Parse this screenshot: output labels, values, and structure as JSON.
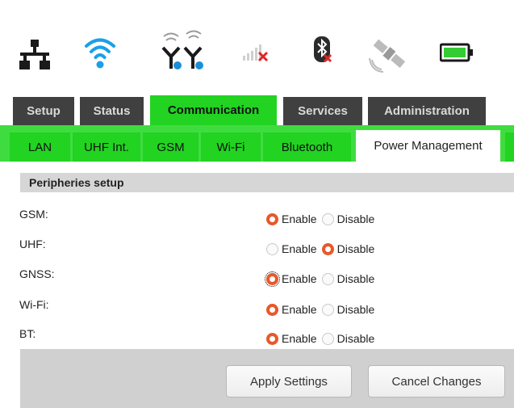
{
  "status_icons": [
    {
      "name": "ethernet-icon",
      "color": "#1a1a1a"
    },
    {
      "name": "wifi-icon",
      "color": "#1aa0e6"
    },
    {
      "name": "uhf-antenna-icon",
      "color": "#1a1a1a"
    },
    {
      "name": "gsm-signal-icon",
      "color": "#cfcfcf"
    },
    {
      "name": "bluetooth-icon",
      "color": "#2b2b2b"
    },
    {
      "name": "satellite-icon",
      "color": "#bbbbbb"
    },
    {
      "name": "battery-icon",
      "color": "#33cc33"
    }
  ],
  "main_tabs": [
    {
      "label": "Setup"
    },
    {
      "label": "Status"
    },
    {
      "label": "Communication",
      "active": true
    },
    {
      "label": "Services"
    },
    {
      "label": "Administration"
    }
  ],
  "sub_tabs": [
    {
      "label": "LAN"
    },
    {
      "label": "UHF Int."
    },
    {
      "label": "GSM"
    },
    {
      "label": "Wi-Fi"
    },
    {
      "label": "Bluetooth"
    },
    {
      "label": "Power Management",
      "active": true
    }
  ],
  "section": {
    "title": "Peripheries setup"
  },
  "radio_labels": {
    "enable": "Enable",
    "disable": "Disable"
  },
  "peripherals": [
    {
      "label": "GSM:",
      "value": "Enable"
    },
    {
      "label": "UHF:",
      "value": "Disable"
    },
    {
      "label": "GNSS:",
      "value": "Enable",
      "focused": true
    },
    {
      "label": "Wi-Fi:",
      "value": "Enable"
    },
    {
      "label": "BT:",
      "value": "Enable"
    }
  ],
  "buttons": {
    "apply": "Apply Settings",
    "cancel": "Cancel Changes"
  },
  "colors": {
    "accent_green": "#22d322",
    "radio_orange": "#e8582a",
    "tab_dark": "#404040"
  }
}
